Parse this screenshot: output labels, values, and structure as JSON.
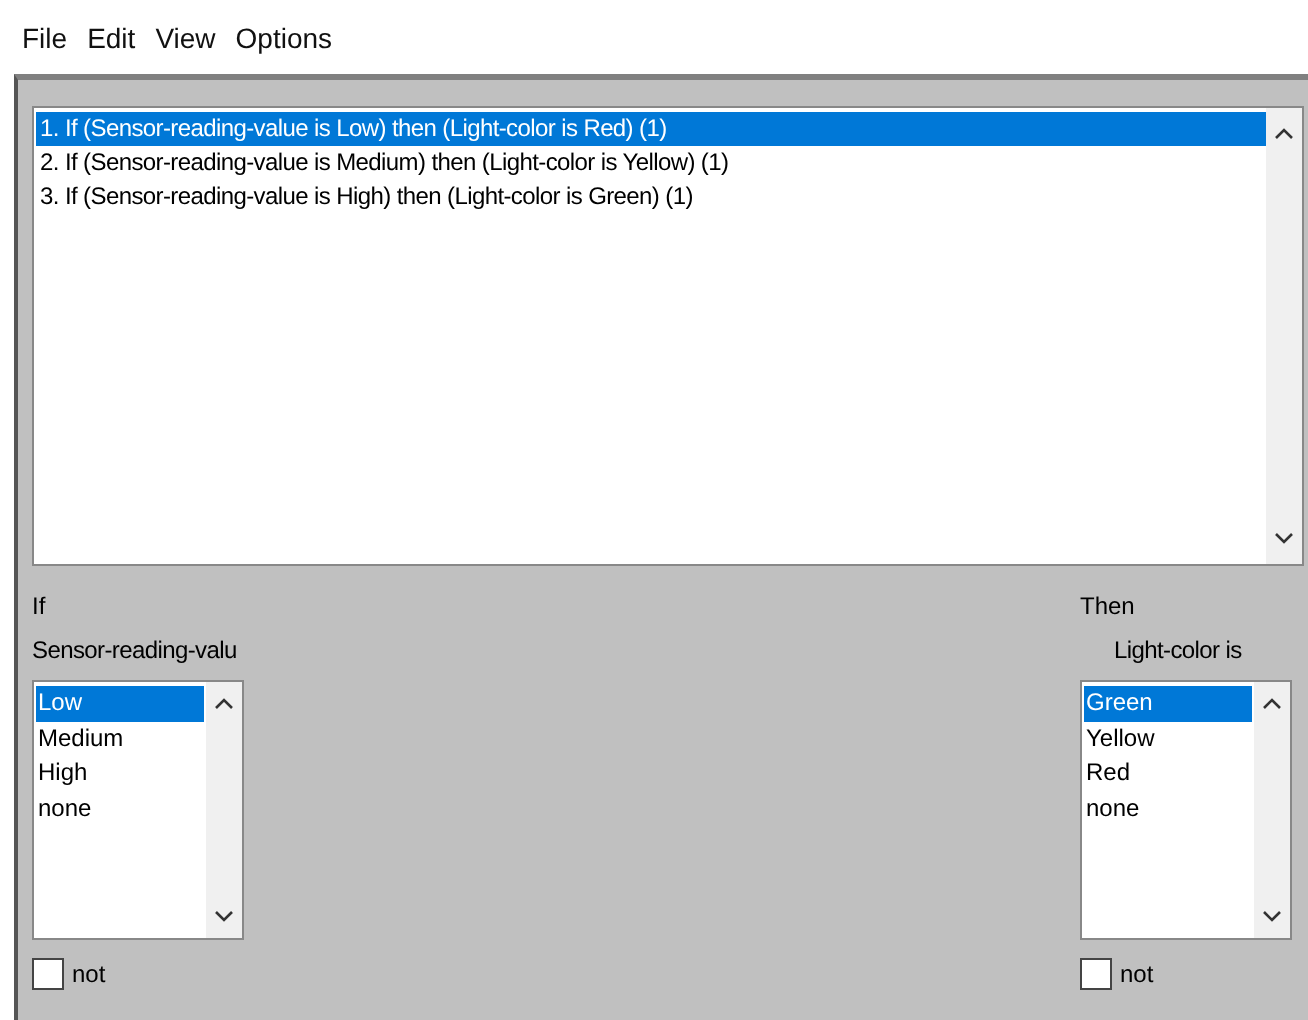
{
  "menu": [
    "File",
    "Edit",
    "View",
    "Options"
  ],
  "rules": [
    {
      "text": "1. If (Sensor-reading-value is Low) then (Light-color is Red) (1)",
      "selected": true
    },
    {
      "text": "2. If (Sensor-reading-value is Medium) then (Light-color is Yellow) (1)",
      "selected": false
    },
    {
      "text": "3. If (Sensor-reading-value is High) then (Light-color is Green) (1)",
      "selected": false
    }
  ],
  "if_panel": {
    "heading": "If",
    "variable": "Sensor-reading-valu",
    "options": [
      {
        "label": "Low",
        "selected": true
      },
      {
        "label": "Medium",
        "selected": false
      },
      {
        "label": "High",
        "selected": false
      },
      {
        "label": "none",
        "selected": false
      }
    ],
    "not": {
      "label": "not",
      "checked": false
    }
  },
  "then_panel": {
    "heading": "Then",
    "variable": "Light-color is",
    "options": [
      {
        "label": "Green",
        "selected": true
      },
      {
        "label": "Yellow",
        "selected": false
      },
      {
        "label": "Red",
        "selected": false
      },
      {
        "label": "none",
        "selected": false
      }
    ],
    "not": {
      "label": "not",
      "checked": false
    }
  }
}
